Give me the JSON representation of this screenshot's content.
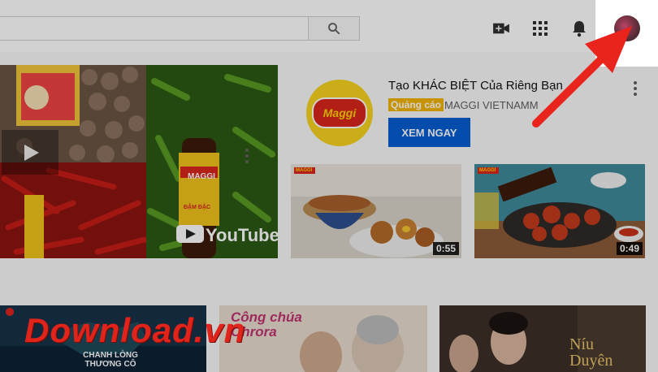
{
  "topbar": {
    "search_icon": "search-icon",
    "icons": [
      "video-camera-plus-icon",
      "apps-grid-icon",
      "bell-icon"
    ]
  },
  "main_video": {
    "label_bottle": "MAGGI",
    "label_sub": "ĐẬM ĐẶC",
    "youtube_text": "YouTube"
  },
  "ad": {
    "title": "Tạo KHÁC BIỆT Của Riêng Bạn",
    "badge": "Quảng cáo",
    "channel": "MAGGI VIETNAMM",
    "button": "XEM NGAY",
    "logo_text": "Maggi"
  },
  "small_videos": [
    {
      "duration": "0:55",
      "brand": "MAGGI"
    },
    {
      "duration": "0:49",
      "brand": "MAGGI"
    }
  ],
  "row2": [
    {
      "title": "CHANH LÒNG THƯƠNG CÔ"
    },
    {
      "title": "Công chúa Ohrora"
    },
    {
      "title": "Níu Duyên"
    }
  ],
  "watermark": "Download.vn",
  "colors": {
    "accent": "#065fd4",
    "ad_badge": "#f4b400",
    "arrow": "#e8241c",
    "maggi_yellow": "#f7d41e"
  }
}
